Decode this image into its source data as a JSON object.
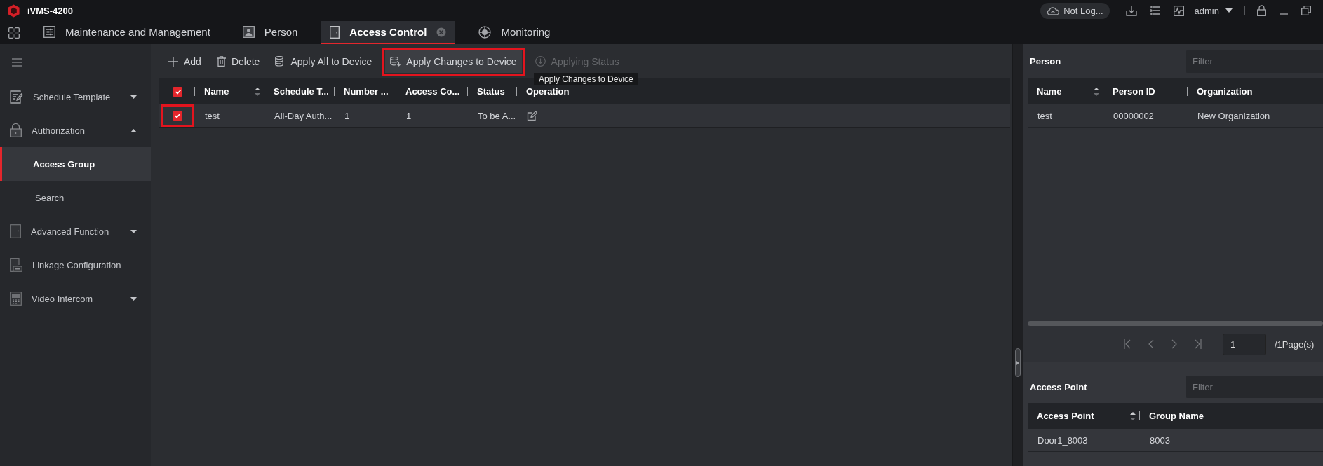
{
  "app": {
    "title": "iVMS-4200"
  },
  "header_tools": {
    "cloud_status": "Not Log...",
    "user": "admin"
  },
  "tabs": [
    {
      "label": "Maintenance and Management",
      "selected": false
    },
    {
      "label": "Person",
      "selected": false
    },
    {
      "label": "Access Control",
      "selected": true
    },
    {
      "label": "Monitoring",
      "selected": false
    }
  ],
  "sidebar": {
    "items": [
      {
        "kind": "group",
        "label": "Schedule Template",
        "expanded": false
      },
      {
        "kind": "group",
        "label": "Authorization",
        "expanded": true,
        "children": [
          {
            "label": "Access Group",
            "selected": true
          },
          {
            "label": "Search",
            "selected": false
          }
        ]
      },
      {
        "kind": "group",
        "label": "Advanced Function",
        "expanded": false
      },
      {
        "kind": "link",
        "label": "Linkage Configuration"
      },
      {
        "kind": "group",
        "label": "Video Intercom",
        "expanded": false
      }
    ]
  },
  "toolbar": {
    "buttons": [
      {
        "label": "Add",
        "disabled": false,
        "hovered": false,
        "highlighted": false
      },
      {
        "label": "Delete",
        "disabled": false,
        "hovered": false,
        "highlighted": false
      },
      {
        "label": "Apply All to Device",
        "disabled": false,
        "hovered": false,
        "highlighted": false
      },
      {
        "label": "Apply Changes to Device",
        "disabled": false,
        "hovered": true,
        "highlighted": true
      },
      {
        "label": "Applying Status",
        "disabled": true,
        "hovered": false,
        "highlighted": false
      }
    ]
  },
  "tooltip": {
    "text": "Apply Changes to Device"
  },
  "access_groups": {
    "header_checked": true,
    "columns": [
      {
        "label": "Name",
        "sortable": true
      },
      {
        "label": "Schedule T...",
        "sortable": false
      },
      {
        "label": "Number ...",
        "sortable": false
      },
      {
        "label": "Access Co...",
        "sortable": false
      },
      {
        "label": "Status",
        "sortable": false
      },
      {
        "label": "Operation",
        "sortable": false
      }
    ],
    "rows": [
      {
        "checked": true,
        "highlighted": true,
        "cells": [
          "test",
          "All-Day Auth...",
          "1",
          "1",
          "To be A..."
        ]
      }
    ]
  },
  "person_panel": {
    "title": "Person",
    "filter": {
      "placeholder": "Filter"
    },
    "columns": [
      {
        "label": "Name",
        "sortable": true
      },
      {
        "label": "Person ID",
        "sortable": false
      },
      {
        "label": "Organization",
        "sortable": false
      }
    ],
    "rows": [
      {
        "cells": [
          "test",
          "00000002",
          "New Organization"
        ]
      }
    ],
    "pager": {
      "page": "1",
      "total": "/1Page(s)"
    }
  },
  "access_point_panel": {
    "title": "Access Point",
    "filter": {
      "placeholder": "Filter"
    },
    "columns": [
      {
        "label": "Access Point",
        "sortable": true
      },
      {
        "label": "Group Name",
        "sortable": false
      }
    ],
    "rows": [
      {
        "cells": [
          "Door1_8003",
          "8003"
        ]
      }
    ]
  }
}
